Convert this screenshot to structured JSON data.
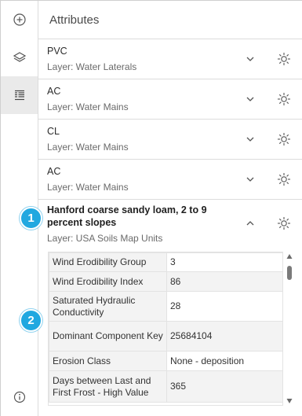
{
  "panel": {
    "title": "Attributes"
  },
  "items": [
    {
      "title": "PVC",
      "subtitle": "Layer: Water Laterals"
    },
    {
      "title": "AC",
      "subtitle": "Layer: Water Mains"
    },
    {
      "title": "CL",
      "subtitle": "Layer: Water Mains"
    },
    {
      "title": "AC",
      "subtitle": "Layer: Water Mains"
    }
  ],
  "expanded": {
    "title": "Hanford coarse sandy loam, 2 to 9 percent slopes",
    "subtitle": "Layer: USA Soils Map Units",
    "rows": [
      {
        "key": "Wind Erodibility Group",
        "value": "3"
      },
      {
        "key": "Wind Erodibility Index",
        "value": "86"
      },
      {
        "key": "Saturated Hydraulic Conductivity",
        "value": "28"
      },
      {
        "key": "Dominant Component Key",
        "value": "25684104"
      },
      {
        "key": "Erosion Class",
        "value": "None - deposition"
      },
      {
        "key": "Days between Last and First Frost - High Value",
        "value": "365"
      }
    ]
  },
  "callouts": {
    "one": "1",
    "two": "2"
  },
  "colors": {
    "callout": "#21a8e0"
  }
}
